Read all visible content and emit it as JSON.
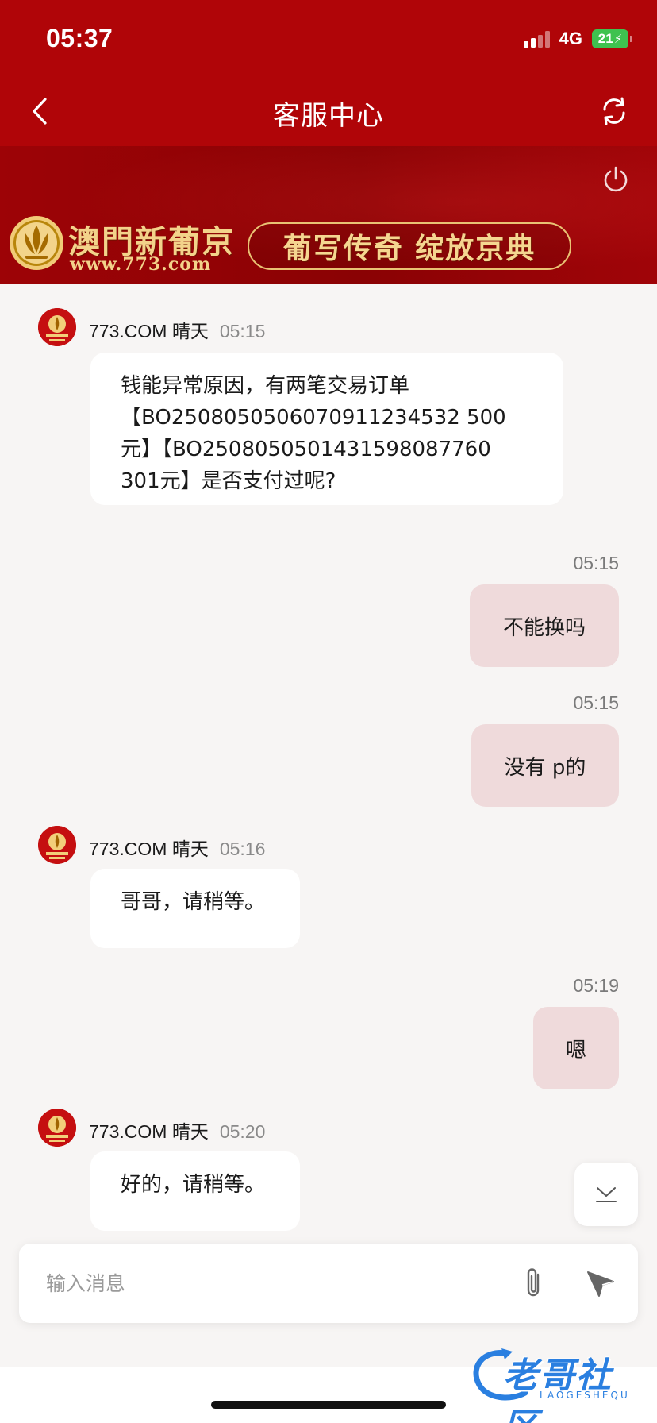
{
  "status_bar": {
    "time": "05:37",
    "network": "4G",
    "battery": "21"
  },
  "nav": {
    "title": "客服中心"
  },
  "banner": {
    "brand_name": "澳門新葡京",
    "brand_url": "www.773.com",
    "slogan": "葡写传奇  绽放京典"
  },
  "messages": [
    {
      "side": "in",
      "sender": "773.COM 晴天",
      "time": "05:15",
      "lines": [
        "钱能异常原因，有两笔交易订单",
        "【BO250805050607091123453​2 500",
        "元】【BO250805050143159808776​0",
        "301元】是否支付过呢?"
      ]
    },
    {
      "side": "out",
      "time": "05:15",
      "text": "不能换吗"
    },
    {
      "side": "out",
      "time": "05:15",
      "text": "没有 p的"
    },
    {
      "side": "in",
      "sender": "773.COM 晴天",
      "time": "05:16",
      "text": "哥哥，请稍等。"
    },
    {
      "side": "out",
      "time": "05:19",
      "text": "嗯"
    },
    {
      "side": "in",
      "sender": "773.COM 晴天",
      "time": "05:20",
      "text": "好的，请稍等。"
    }
  ],
  "input": {
    "placeholder": "输入消息"
  },
  "watermark": {
    "text": "老哥社区",
    "sub": "LAOGESHEQU"
  }
}
